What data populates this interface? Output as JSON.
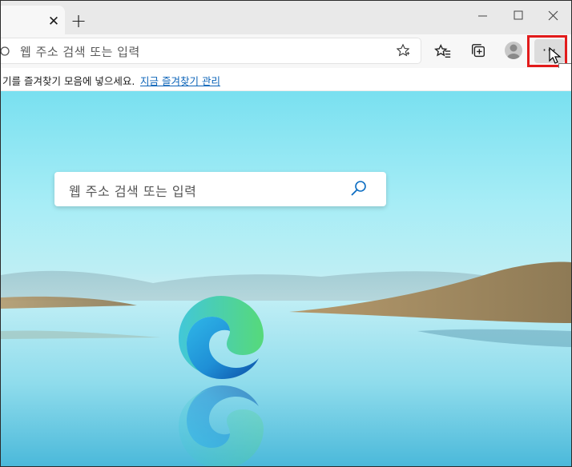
{
  "browser": {
    "new_tab_symbol": "+",
    "close_tab_symbol": "✕"
  },
  "address_bar": {
    "placeholder": "웹 주소 검색 또는 입력"
  },
  "toolbar": {
    "more_label": "···"
  },
  "favorites_bar": {
    "prompt": "기를 즐겨찾기 모음에 넣으세요.",
    "manage_link": "지금 즐겨찾기 관리"
  },
  "new_tab_page": {
    "search_placeholder": "웹 주소 검색 또는 입력"
  },
  "colors": {
    "highlight": "#e21b1b",
    "link": "#0b63b8"
  },
  "icons": [
    "close-icon",
    "new-tab-icon",
    "minimize-icon",
    "maximize-icon",
    "window-close-icon",
    "search-icon",
    "star-icon",
    "favorites-icon",
    "collections-icon",
    "profile-icon",
    "more-icon",
    "edge-logo"
  ]
}
